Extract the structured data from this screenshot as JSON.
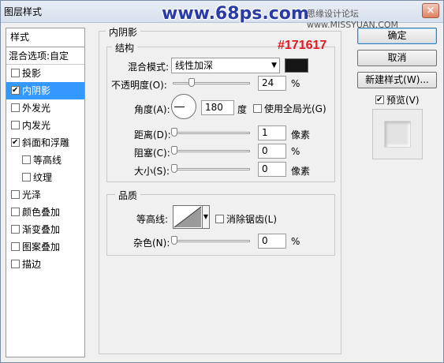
{
  "window": {
    "title": "图层样式",
    "close_symbol": "×"
  },
  "watermark": "www.68ps.com",
  "site_credit": "思缘设计论坛 www.MISSYUAN.COM",
  "annotation": {
    "color_hex": "#171617"
  },
  "sidebar": {
    "header": "样式",
    "blend_options": "混合选项:自定",
    "items": [
      {
        "label": "投影",
        "checked": false,
        "sub": false,
        "selected": false
      },
      {
        "label": "内阴影",
        "checked": true,
        "sub": false,
        "selected": true
      },
      {
        "label": "外发光",
        "checked": false,
        "sub": false,
        "selected": false
      },
      {
        "label": "内发光",
        "checked": false,
        "sub": false,
        "selected": false
      },
      {
        "label": "斜面和浮雕",
        "checked": true,
        "sub": false,
        "selected": false
      },
      {
        "label": "等高线",
        "checked": false,
        "sub": true,
        "selected": false
      },
      {
        "label": "纹理",
        "checked": false,
        "sub": true,
        "selected": false
      },
      {
        "label": "光泽",
        "checked": false,
        "sub": false,
        "selected": false
      },
      {
        "label": "颜色叠加",
        "checked": false,
        "sub": false,
        "selected": false
      },
      {
        "label": "渐变叠加",
        "checked": false,
        "sub": false,
        "selected": false
      },
      {
        "label": "图案叠加",
        "checked": false,
        "sub": false,
        "selected": false
      },
      {
        "label": "描边",
        "checked": false,
        "sub": false,
        "selected": false
      }
    ]
  },
  "panel": {
    "title": "内阴影",
    "structure": {
      "title": "结构",
      "blend_mode_label": "混合模式:",
      "blend_mode_value": "线性加深",
      "color_swatch": "#171617",
      "opacity_label": "不透明度(O):",
      "opacity_value": "24",
      "opacity_unit": "%",
      "opacity_fraction": 0.24,
      "angle_label": "角度(A):",
      "angle_value": "180",
      "angle_unit": "度",
      "global_light_label": "使用全局光(G)",
      "global_light_checked": false,
      "distance_label": "距离(D):",
      "distance_value": "1",
      "distance_unit": "像素",
      "choke_label": "阻塞(C):",
      "choke_value": "0",
      "choke_unit": "%",
      "size_label": "大小(S):",
      "size_value": "0",
      "size_unit": "像素"
    },
    "quality": {
      "title": "品质",
      "contour_label": "等高线:",
      "anti_alias_label": "消除锯齿(L)",
      "anti_alias_checked": false,
      "noise_label": "杂色(N):",
      "noise_value": "0",
      "noise_unit": "%"
    }
  },
  "buttons": {
    "ok": "确定",
    "cancel": "取消",
    "new_style": "新建样式(W)...",
    "preview_label": "预览(V)",
    "preview_checked": true
  }
}
